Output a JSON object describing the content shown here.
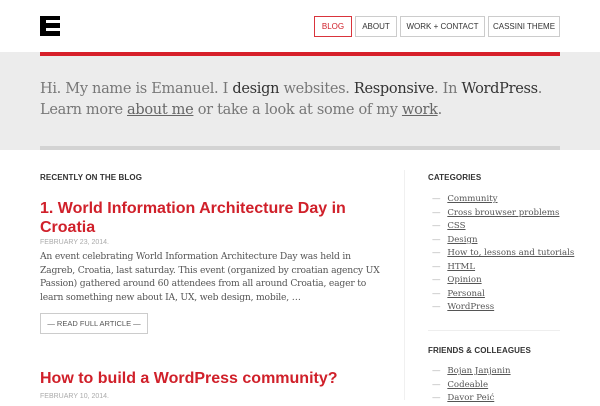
{
  "header": {
    "logo": "E",
    "nav": [
      {
        "label": "BLOG",
        "active": true
      },
      {
        "label": "ABOUT"
      },
      {
        "label": "WORK + CONTACT"
      },
      {
        "label": "CASSINI THEME"
      }
    ]
  },
  "intro": {
    "t1": "Hi. My name is Emanuel. I ",
    "design": "design",
    "t2": " websites. ",
    "responsive": "Responsive",
    "t3": ". In ",
    "wordpress": "WordPress",
    "t4": ". Learn more ",
    "about": "about me",
    "t5": " or take a look at some of my ",
    "work": "work",
    "t6": "."
  },
  "blog": {
    "heading": "RECENTLY ON THE BLOG",
    "posts": [
      {
        "title": "1. World Information Architecture Day in Croatia",
        "date": "FEBRUARY 23, 2014.",
        "excerpt": "An event celebrating World Information Architecture Day was held in Zagreb, Croatia, last saturday. This event (organized by croatian agency UX Passion) gathered around 60 attendees from all around Croatia, eager to learn something new about IA, UX, web design, mobile, …",
        "read_more": "— READ FULL ARTICLE —"
      },
      {
        "title": "How to build a WordPress community?",
        "date": "FEBRUARY 10, 2014."
      }
    ]
  },
  "sidebar": {
    "categories_heading": "CATEGORIES",
    "categories": [
      "Community",
      "Cross brouwser problems",
      "CSS",
      "Design",
      "How to, lessons and tutorials",
      "HTML",
      "Opinion",
      "Personal",
      "WordPress"
    ],
    "friends_heading": "FRIENDS & COLLEAGUES",
    "friends": [
      "Bojan Janjanin",
      "Codeable",
      "Davor Peić"
    ]
  }
}
